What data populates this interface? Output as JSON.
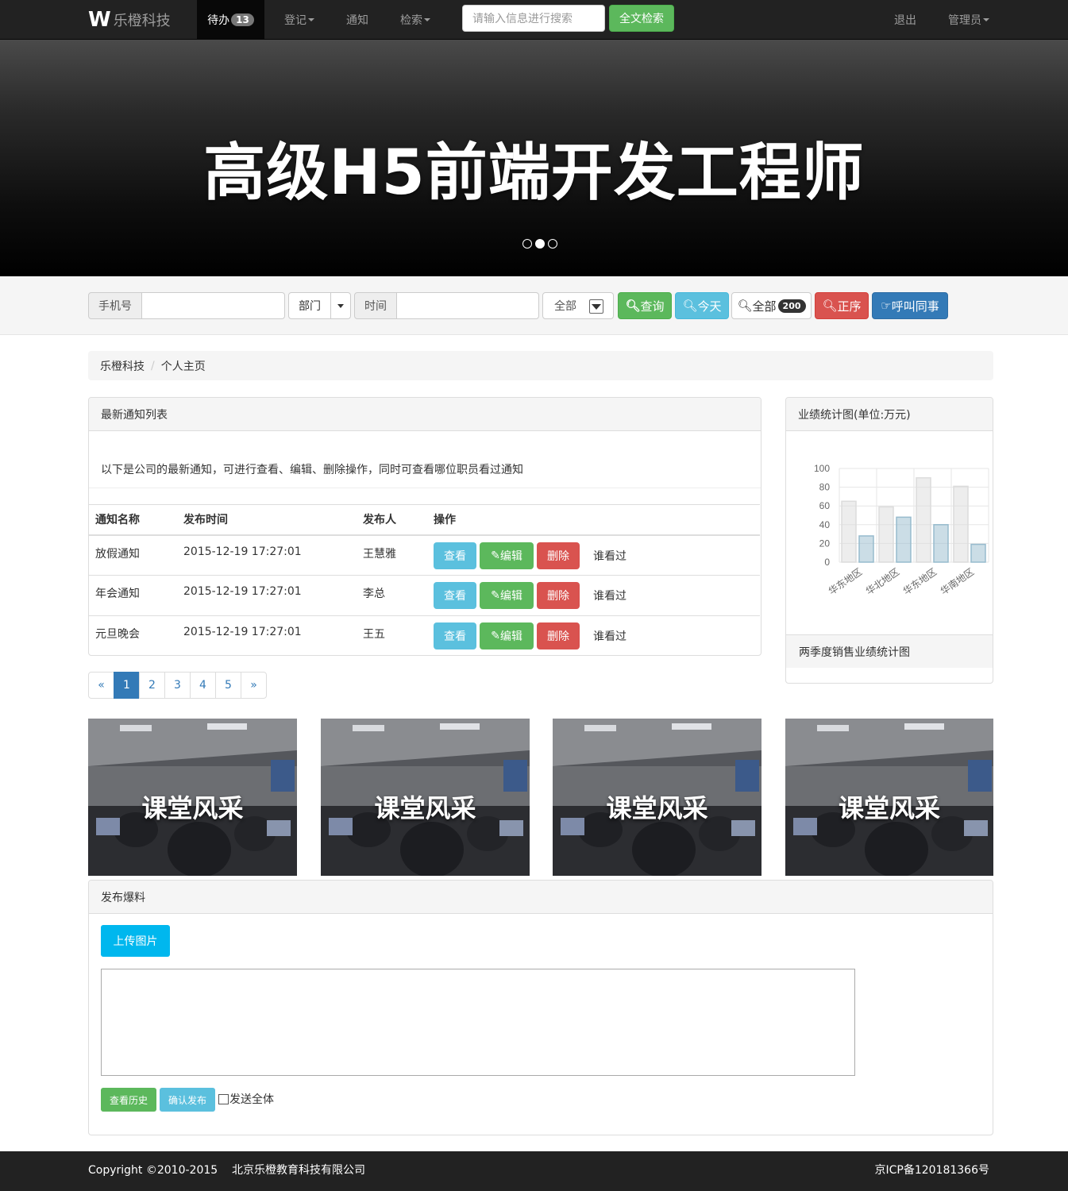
{
  "navbar": {
    "brand": "乐橙科技",
    "active_item": "待办",
    "active_badge": "13",
    "items": [
      "登记",
      "通知",
      "检索"
    ],
    "search_placeholder": "请输入信息进行搜索",
    "search_button": "全文检索",
    "logout": "退出",
    "admin": "管理员"
  },
  "carousel": {
    "title": "高级H5前端开发工程师",
    "slide_count": 3,
    "active_slide": 2
  },
  "search_bar": {
    "phone_label": "手机号",
    "dept_label": "部门",
    "time_label": "时间",
    "select_value": "全部",
    "btn_query": "查询",
    "btn_today": "今天",
    "btn_all": "全部",
    "btn_all_badge": "200",
    "btn_sort": "正序",
    "btn_call": "呼叫同事"
  },
  "breadcrumb": [
    "乐橙科技",
    "个人主页"
  ],
  "notices": {
    "title": "最新通知列表",
    "description": "以下是公司的最新通知，可进行查看、编辑、删除操作，同时可查看哪位职员看过通知",
    "columns": [
      "通知名称",
      "发布时间",
      "发布人",
      "操作"
    ],
    "rows": [
      {
        "name": "放假通知",
        "time": "2015-12-19 17:27:01",
        "publisher": "王慧雅"
      },
      {
        "name": "年会通知",
        "time": "2015-12-19 17:27:01",
        "publisher": "李总"
      },
      {
        "name": "元旦晚会",
        "time": "2015-12-19 17:27:01",
        "publisher": "王五"
      }
    ],
    "actions": {
      "view": "查看",
      "edit": "编辑",
      "delete": "删除",
      "who": "谁看过"
    }
  },
  "pagination": [
    "«",
    "1",
    "2",
    "3",
    "4",
    "5",
    "»"
  ],
  "pagination_active": "1",
  "chart_panel": {
    "title": "业绩统计图(单位:万元)",
    "caption": "两季度销售业绩统计图"
  },
  "chart_data": {
    "type": "bar",
    "categories": [
      "华东地区",
      "华北地区",
      "华东地区",
      "华南地区"
    ],
    "series": [
      {
        "values": [
          65,
          59,
          90,
          81
        ]
      },
      {
        "values": [
          28,
          48,
          40,
          19
        ]
      }
    ],
    "ylim": [
      0,
      100
    ],
    "yticks": [
      0,
      20,
      40,
      60,
      80,
      100
    ],
    "colors": [
      "#dcdcdc",
      "#97bbcd"
    ],
    "grid": true
  },
  "photos": [
    "课堂风采",
    "课堂风采",
    "课堂风采",
    "课堂风采"
  ],
  "publish": {
    "title": "发布爆料",
    "upload_button": "上传图片",
    "history_button": "查看历史",
    "confirm_button": "确认发布",
    "send_all_label": "发送全体"
  },
  "footer": {
    "copyright": "Copyright ©2010-2015",
    "company": "北京乐橙教育科技有限公司",
    "icp": "京ICP备120181366号"
  }
}
